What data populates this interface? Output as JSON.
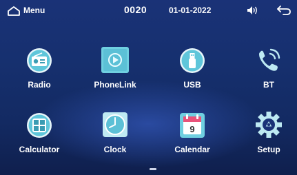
{
  "status_bar": {
    "home_icon": "home-icon",
    "title": "Menu",
    "time": "0020",
    "date": "01-01-2022",
    "volume_icon": "volume-icon",
    "back_icon": "back-arrow-icon"
  },
  "apps": [
    {
      "label": "Radio",
      "icon": "radio-icon"
    },
    {
      "label": "PhoneLink",
      "icon": "phonelink-icon"
    },
    {
      "label": "USB",
      "icon": "usb-icon"
    },
    {
      "label": "BT",
      "icon": "bluetooth-phone-icon"
    },
    {
      "label": "Calculator",
      "icon": "calculator-icon"
    },
    {
      "label": "Clock",
      "icon": "clock-icon"
    },
    {
      "label": "Calendar",
      "icon": "calendar-icon"
    },
    {
      "label": "Setup",
      "icon": "gear-icon"
    }
  ],
  "calendar_day": "9",
  "colors": {
    "background": "#16306f",
    "text": "#ffffff",
    "icon_teal": "#6fd0e0"
  }
}
